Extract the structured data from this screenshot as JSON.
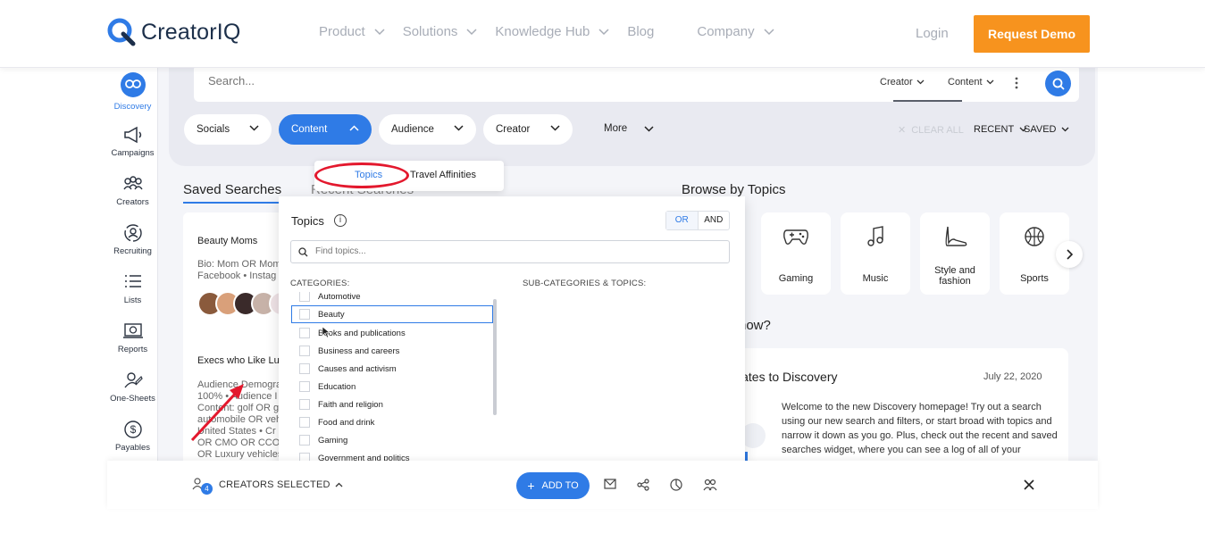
{
  "header": {
    "logo_text": "CreatorIQ",
    "nav": [
      "Product",
      "Solutions",
      "Knowledge Hub",
      "Blog",
      "Company"
    ],
    "login": "Login",
    "demo": "Request Demo"
  },
  "sidebar": {
    "items": [
      {
        "label": "Discovery",
        "icon": "binoculars-icon"
      },
      {
        "label": "Campaigns",
        "icon": "megaphone-icon"
      },
      {
        "label": "Creators",
        "icon": "people-icon"
      },
      {
        "label": "Recruiting",
        "icon": "recruit-icon"
      },
      {
        "label": "Lists",
        "icon": "list-icon"
      },
      {
        "label": "Reports",
        "icon": "report-icon"
      },
      {
        "label": "One-Sheets",
        "icon": "onesheet-icon"
      },
      {
        "label": "Payables",
        "icon": "dollar-icon"
      }
    ]
  },
  "search": {
    "placeholder": "Search...",
    "creator_dd": "Creator",
    "content_dd": "Content"
  },
  "filters": {
    "socials": "Socials",
    "content": "Content",
    "audience": "Audience",
    "creator": "Creator",
    "more": "More",
    "clear_all": "CLEAR ALL",
    "recent": "RECENT",
    "saved": "SAVED"
  },
  "submenu": {
    "topics": "Topics",
    "travel": "Travel Affinities"
  },
  "tabs": {
    "saved": "Saved Searches",
    "recent": "Recent Searches"
  },
  "saved_card": {
    "title1": "Beauty Moms",
    "line1a": "Bio: Mom OR Mom",
    "line1b": "Facebook  • Instag",
    "title2": "Execs who Like Lu",
    "line2a": "Audience Demogra",
    "line2b": "100%  • Audience I",
    "line2c": "Content: golf OR g",
    "line2d": "automobile OR veh",
    "line2e": "United States  • Cr",
    "line2f": "OR CMO OR CCO",
    "line2g": "OR Luxury vehicles"
  },
  "topics_panel": {
    "title": "Topics",
    "or": "OR",
    "and": "AND",
    "find_placeholder": "Find topics...",
    "categories_label": "CATEGORIES:",
    "sub_label": "SUB-CATEGORIES & TOPICS:",
    "categories": [
      "Automotive",
      "Beauty",
      "Books and publications",
      "Business and careers",
      "Causes and activism",
      "Education",
      "Faith and religion",
      "Food and drink",
      "Gaming",
      "Government and politics"
    ]
  },
  "browse": {
    "title": "Browse by Topics",
    "topics": [
      {
        "label": "Gaming",
        "icon": "gamepad-icon"
      },
      {
        "label": "Music",
        "icon": "music-note-icon"
      },
      {
        "label": "Style and fashion",
        "icon": "high-heel-icon"
      },
      {
        "label": "Sports",
        "icon": "basketball-icon"
      }
    ]
  },
  "know": {
    "title": "now?"
  },
  "news": {
    "heading": "lates to Discovery",
    "date": "July 22, 2020",
    "body": "Welcome to the new Discovery homepage! Try out a search using our new search and filters, or start broad with topics and narrow it down as you go. Plus, check out the recent and saved searches widget, where you can see a log of all of your"
  },
  "help": "?",
  "bottom": {
    "creators_selected": "CREATORS SELECTED",
    "count": "4",
    "add_to": "ADD TO"
  },
  "colors": {
    "accent": "#2f7be6",
    "demo_orange": "#f7931e",
    "highlight_red": "#e3182d"
  }
}
